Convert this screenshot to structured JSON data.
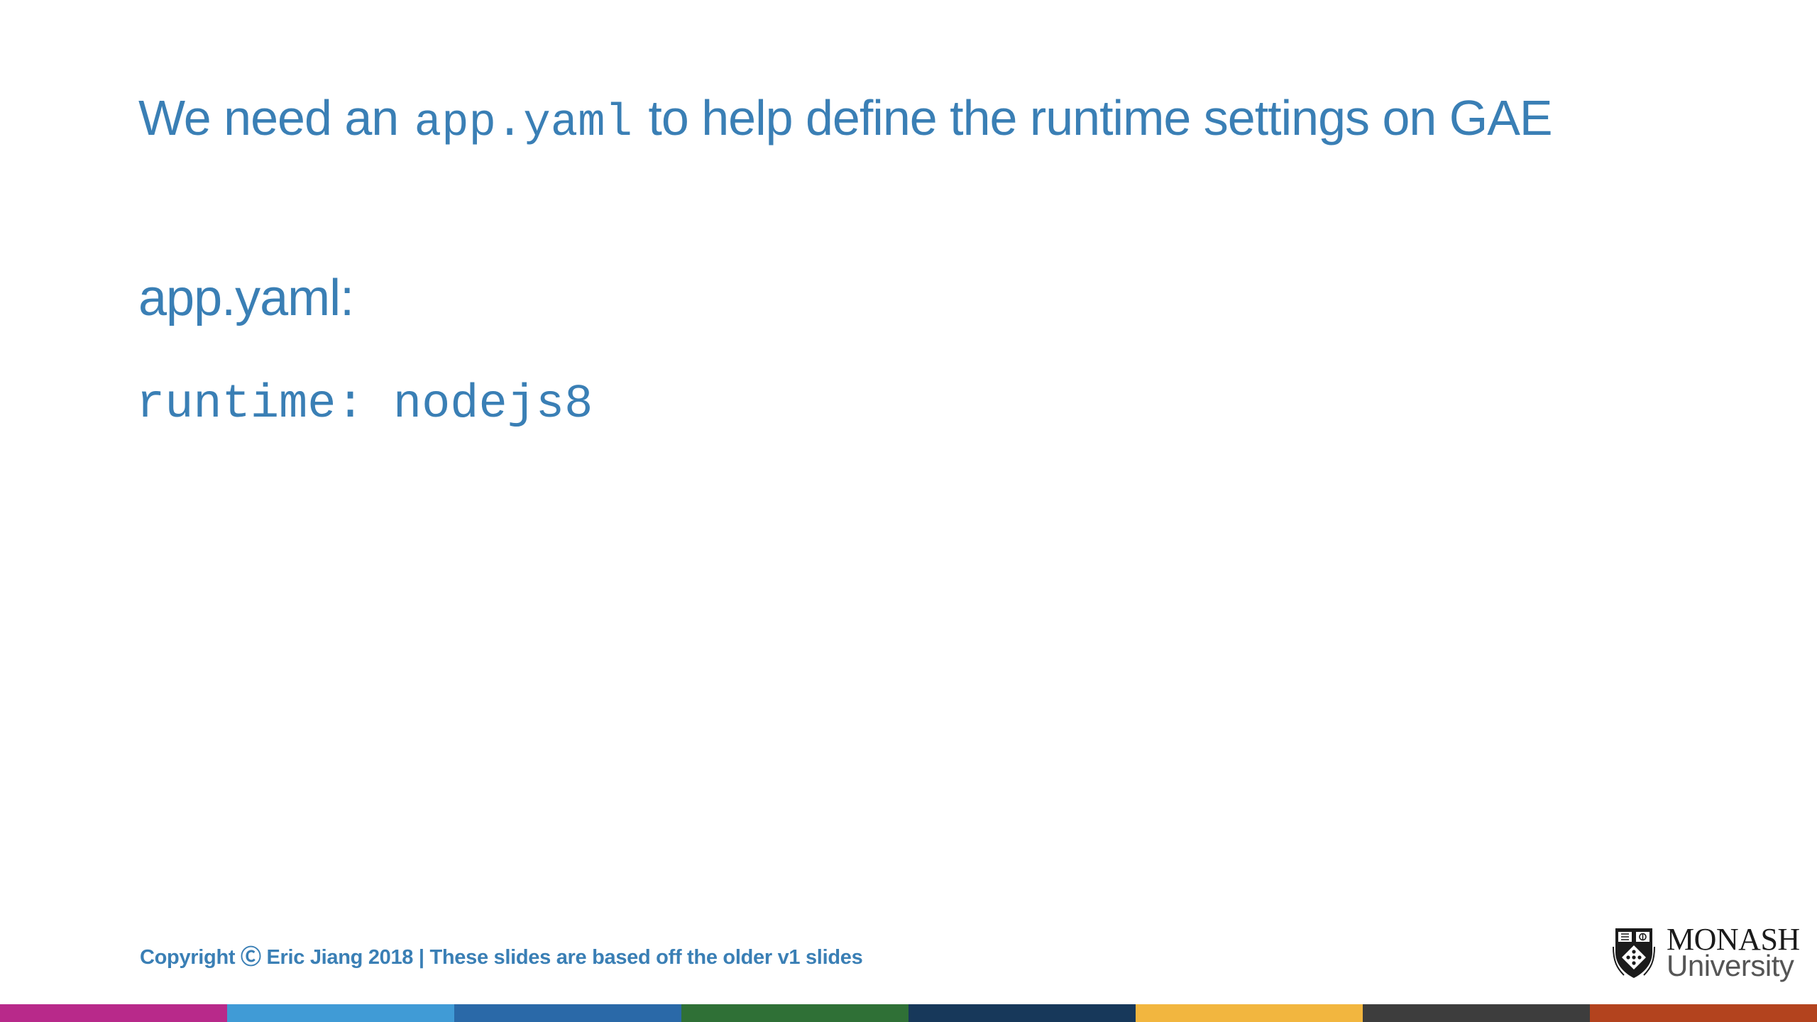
{
  "slide": {
    "title": {
      "before": "We need an",
      "code": "app.yaml",
      "after": "to help define the runtime settings on GAE"
    },
    "heading": "app.yaml:",
    "code_line": "runtime: nodejs8",
    "footer": "Copyright Ⓒ Eric Jiang 2018 | These slides are based off the older v1 slides"
  },
  "logo": {
    "name": "monash-university-logo",
    "line1": "MONASH",
    "line2": "University"
  },
  "colors": {
    "accent": "#3a7fb5",
    "bar": [
      "#b8298a",
      "#409bd6",
      "#2a69a8",
      "#2f7036",
      "#17385a",
      "#f2b63f",
      "#3d3d3d",
      "#b3431e"
    ]
  }
}
